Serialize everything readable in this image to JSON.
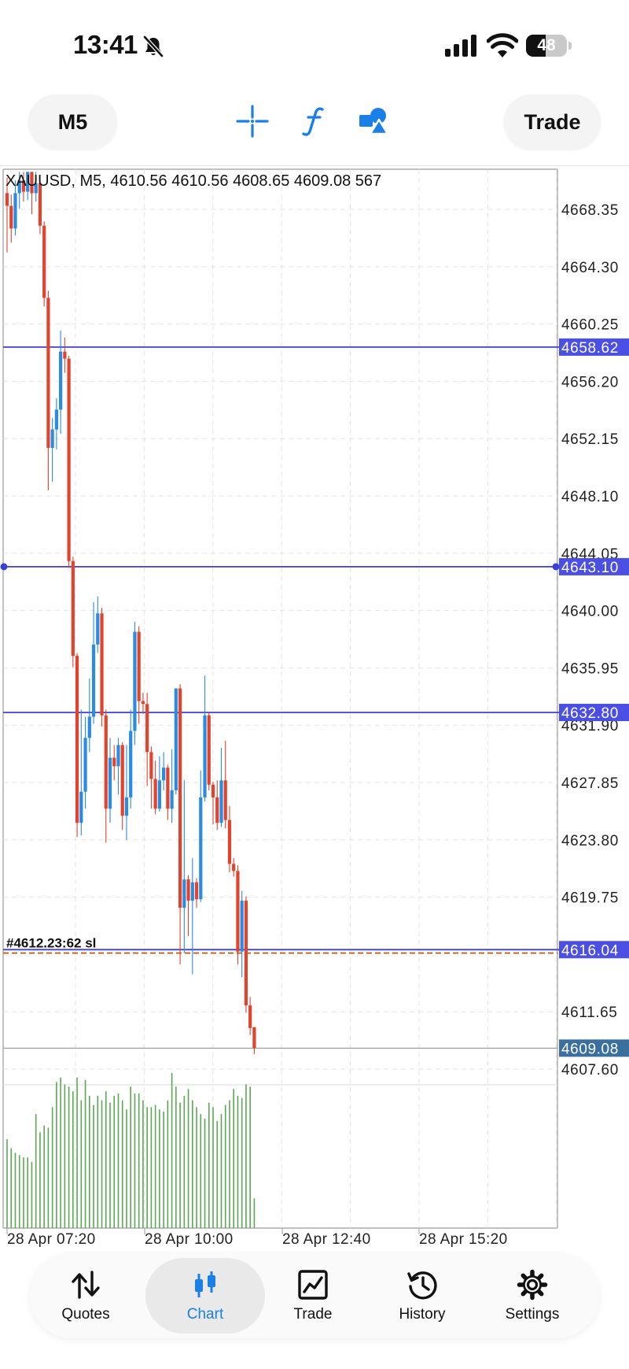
{
  "status_bar": {
    "time": "13:41",
    "battery": "48",
    "battery_level": 0.48
  },
  "toolbar": {
    "timeframe": "M5",
    "trade_label": "Trade",
    "icons": [
      "crosshair-icon",
      "indicators-icon",
      "objects-icon"
    ]
  },
  "chart": {
    "info_line": "XAUUSD, M5, 4610.56 4610.56 4608.65 4609.08 567",
    "price_labels": [
      "4668.35",
      "4664.30",
      "4660.25",
      "4656.20",
      "4652.15",
      "4648.10",
      "4644.05",
      "4640.00",
      "4635.95",
      "4631.90",
      "4627.85",
      "4623.80",
      "4619.75",
      "4611.65",
      "4607.60"
    ],
    "time_labels": [
      "28 Apr 07:20",
      "28 Apr 10:00",
      "28 Apr 12:40",
      "28 Apr 15:20"
    ],
    "level_tags": [
      "4658.62",
      "4643.10",
      "4632.80",
      "4616.04",
      "4609.08"
    ],
    "overlapping_label": "#4612.23:62 sl",
    "colors": {
      "bull": "#2a8be0",
      "bear": "#e2432d",
      "level_line": "#3b3fd8",
      "level_tag": "#4b4fe3",
      "bid_tag": "#3a6f9f",
      "sl_line": "#c46a1d",
      "volume": "#5aa852",
      "grid": "#e3e3e3"
    }
  },
  "chart_data": {
    "type": "candlestick",
    "symbol": "XAUUSD",
    "timeframe": "M5",
    "last": {
      "open": 4610.56,
      "high": 4610.56,
      "low": 4608.65,
      "close": 4609.08,
      "volume": 567
    },
    "y_range": [
      4604,
      4671
    ],
    "x_range": [
      "28 Apr 06:50",
      "28 Apr 17:10"
    ],
    "levels": [
      4658.62,
      4643.1,
      4632.8,
      4616.04
    ],
    "stop_loss_line": 4615.8,
    "bid": 4609.08,
    "candles": [
      [
        4669.5,
        4668.6,
        4670.6,
        4665.3
      ],
      [
        4668.6,
        4667.0,
        4669.4,
        4666.0
      ],
      [
        4667.0,
        4669.5,
        4670.4,
        4666.5
      ],
      [
        4669.5,
        4670.4,
        4671.0,
        4668.4
      ],
      [
        4670.4,
        4669.6,
        4671.0,
        4668.9
      ],
      [
        4669.6,
        4671.0,
        4671.0,
        4669.0
      ],
      [
        4671.0,
        4669.5,
        4671.0,
        4668.0
      ],
      [
        4669.5,
        4670.2,
        4671.0,
        4668.9
      ],
      [
        4670.2,
        4667.2,
        4670.8,
        4666.6
      ],
      [
        4667.2,
        4662.1,
        4667.5,
        4661.5
      ],
      [
        4662.1,
        4651.5,
        4662.6,
        4648.5
      ],
      [
        4651.5,
        4652.8,
        4653.6,
        4649.1
      ],
      [
        4652.8,
        4654.2,
        4655.0,
        4651.4
      ],
      [
        4654.2,
        4658.3,
        4659.8,
        4652.5
      ],
      [
        4658.3,
        4657.8,
        4659.3,
        4656.8
      ],
      [
        4657.8,
        4643.5,
        4658.0,
        4643.0
      ],
      [
        4643.5,
        4636.8,
        4643.8,
        4636.0
      ],
      [
        4636.8,
        4625.0,
        4637.0,
        4624.0
      ],
      [
        4625.0,
        4627.2,
        4633.0,
        4624.1
      ],
      [
        4627.2,
        4631.0,
        4632.5,
        4626.0
      ],
      [
        4631.0,
        4632.5,
        4635.2,
        4630.0
      ],
      [
        4632.5,
        4637.6,
        4640.6,
        4632.0
      ],
      [
        4637.6,
        4639.8,
        4641.0,
        4637.0
      ],
      [
        4639.8,
        4632.6,
        4640.2,
        4631.8
      ],
      [
        4632.6,
        4626.0,
        4633.0,
        4623.6
      ],
      [
        4626.0,
        4629.6,
        4631.0,
        4625.0
      ],
      [
        4629.6,
        4629.0,
        4630.5,
        4628.0
      ],
      [
        4629.0,
        4630.5,
        4631.0,
        4627.0
      ],
      [
        4630.5,
        4625.5,
        4630.7,
        4624.5
      ],
      [
        4625.5,
        4626.8,
        4630.5,
        4623.8
      ],
      [
        4626.8,
        4631.5,
        4633.0,
        4626.0
      ],
      [
        4631.5,
        4638.5,
        4639.2,
        4630.5
      ],
      [
        4638.5,
        4633.6,
        4638.9,
        4632.0
      ],
      [
        4633.6,
        4633.4,
        4634.2,
        4632.7
      ],
      [
        4633.4,
        4630.0,
        4634.2,
        4627.6
      ],
      [
        4630.0,
        4628.1,
        4630.4,
        4626.0
      ],
      [
        4628.1,
        4626.0,
        4629.4,
        4625.6
      ],
      [
        4626.0,
        4628.0,
        4629.7,
        4625.8
      ],
      [
        4628.0,
        4628.9,
        4630.0,
        4627.3
      ],
      [
        4628.9,
        4626.0,
        4629.1,
        4625.2
      ],
      [
        4626.0,
        4627.3,
        4630.2,
        4625.0
      ],
      [
        4627.3,
        4634.5,
        4634.5,
        4627.0
      ],
      [
        4634.5,
        4619.0,
        4634.8,
        4615.0
      ],
      [
        4619.0,
        4621.0,
        4628.0,
        4615.8
      ],
      [
        4621.0,
        4619.5,
        4621.3,
        4617.0
      ],
      [
        4619.5,
        4620.8,
        4622.5,
        4614.3
      ],
      [
        4620.8,
        4619.6,
        4621.1,
        4619.0
      ],
      [
        4619.6,
        4626.8,
        4628.7,
        4619.4
      ],
      [
        4626.8,
        4632.6,
        4635.4,
        4626.5
      ],
      [
        4632.6,
        4627.7,
        4632.8,
        4627.3
      ],
      [
        4627.7,
        4626.8,
        4627.9,
        4624.9
      ],
      [
        4626.8,
        4625.0,
        4628.0,
        4624.5
      ],
      [
        4625.0,
        4628.0,
        4630.3,
        4624.7
      ],
      [
        4628.0,
        4625.2,
        4630.8,
        4624.6
      ],
      [
        4625.2,
        4622.1,
        4626.2,
        4621.5
      ],
      [
        4622.1,
        4621.6,
        4622.5,
        4621.2
      ],
      [
        4621.6,
        4615.9,
        4622.0,
        4615.0
      ],
      [
        4615.9,
        4619.5,
        4620.2,
        4614.1
      ],
      [
        4619.5,
        4612.1,
        4619.8,
        4611.6
      ],
      [
        4612.1,
        4610.5,
        4612.7,
        4610.0
      ],
      [
        4610.56,
        4609.08,
        4610.56,
        4608.65
      ]
    ],
    "volumes": [
      390,
      350,
      330,
      320,
      310,
      310,
      290,
      500,
      420,
      450,
      440,
      530,
      640,
      660,
      630,
      620,
      600,
      660,
      560,
      650,
      580,
      540,
      580,
      560,
      600,
      550,
      580,
      590,
      560,
      520,
      620,
      590,
      590,
      560,
      530,
      530,
      540,
      520,
      510,
      560,
      680,
      620,
      550,
      580,
      610,
      560,
      530,
      500,
      480,
      550,
      530,
      470,
      500,
      540,
      560,
      610,
      580,
      570,
      630,
      620,
      130
    ]
  },
  "bottom_nav": {
    "items": [
      {
        "label": "Quotes",
        "icon": "quotes-arrows-icon"
      },
      {
        "label": "Chart",
        "icon": "candlestick-chart-icon"
      },
      {
        "label": "Trade",
        "icon": "trade-chart-icon"
      },
      {
        "label": "History",
        "icon": "history-clock-icon"
      },
      {
        "label": "Settings",
        "icon": "gear-icon"
      }
    ],
    "active": "Chart"
  }
}
